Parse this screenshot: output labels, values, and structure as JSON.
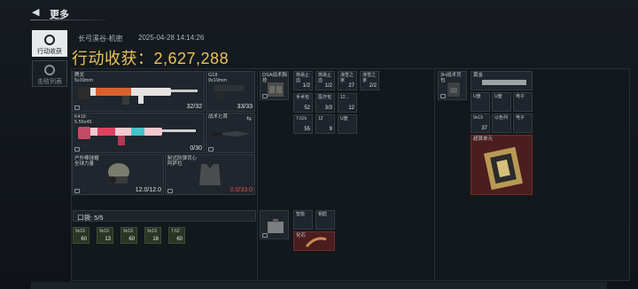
{
  "header": {
    "title": "更多"
  },
  "tabs": [
    {
      "label": "行动收获",
      "active": true
    },
    {
      "label": "击败列表",
      "active": false
    }
  ],
  "summary": {
    "map": "长弓溪谷-机密",
    "datetime": "2025-04-28 14:14:26",
    "earnings_label": "行动收获：",
    "earnings_value": "2,627,288"
  },
  "loadout": {
    "primary": {
      "name": "腾龙",
      "sub": "5x39mm",
      "count": "32/32"
    },
    "secondary": {
      "name": "K416",
      "sub": "5.56x45",
      "count": "0/30"
    },
    "pistol": {
      "name": "G18",
      "sub": "9x19mm",
      "count": "33/33"
    },
    "melee": {
      "name": "战术匕首"
    },
    "helmet": {
      "name": "户外棒球帽",
      "sub": "全球力量",
      "count": "12.0/12.0"
    },
    "armor": {
      "name": "制式防弹背心",
      "sub": "阿萨拉",
      "count": "0.0/33.0"
    }
  },
  "pocket": {
    "label": "口袋: 5/5"
  },
  "pocket_items": [
    {
      "name": "9x19",
      "count": "60"
    },
    {
      "name": "9x19",
      "count": "13"
    },
    {
      "name": "9x19",
      "count": "60"
    },
    {
      "name": "9x19",
      "count": "16"
    },
    {
      "name": "7.62",
      "count": "60"
    }
  ],
  "rig": {
    "slot": {
      "name": "DSA战术胸挂",
      "sub": ""
    },
    "items": [
      {
        "name": "简易止血",
        "count": "1/2"
      },
      {
        "name": "简易止血",
        "count": "1/2"
      },
      {
        "name": "滑雪之家",
        "count": "27"
      },
      {
        "name": "滑雪之家",
        "count": "2/2"
      },
      {
        "name": "手术包",
        "count": "52"
      },
      {
        "name": "医疗包",
        "count": "3/3"
      },
      {
        "name": "12...",
        "count": "12"
      },
      {
        "name": "7.62x",
        "count": "55"
      },
      {
        "name": "12",
        "count": "9"
      },
      {
        "name": "U盘",
        "count": ""
      }
    ]
  },
  "pack": {
    "slot": {
      "name": "3H战术背包"
    },
    "items": [
      {
        "name": "U盘",
        "count": ""
      },
      {
        "name": "U盘",
        "count": ""
      },
      {
        "name": "电子",
        "count": ""
      },
      {
        "name": "弹药",
        "count": ""
      },
      {
        "name": "9x19",
        "count": "37"
      },
      {
        "name": "以色列",
        "count": ""
      },
      {
        "name": "电子",
        "count": ""
      },
      {
        "name": "弹药",
        "count": ""
      },
      {
        "name": "U盘",
        "count": ""
      },
      {
        "name": "电子",
        "count": ""
      }
    ],
    "special_item": {
      "name": "超算单元"
    }
  },
  "case": {
    "items": [
      {
        "name": "智能",
        "count": ""
      },
      {
        "name": "钥匙",
        "count": ""
      },
      {
        "name": "化石",
        "count": ""
      }
    ]
  },
  "case_long": {
    "name": "黄金"
  }
}
